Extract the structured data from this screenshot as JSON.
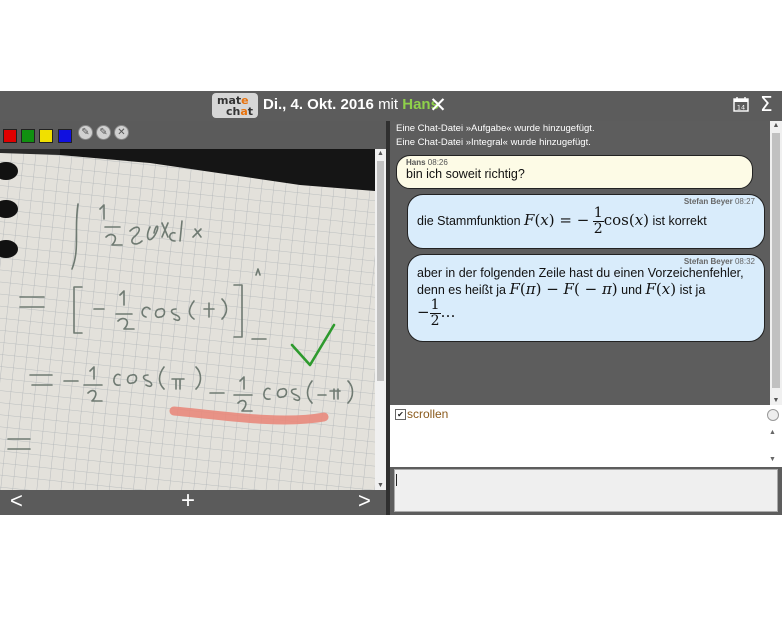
{
  "header": {
    "logo_line1": "mat",
    "logo_e1": "e",
    "logo_line2": "ch",
    "logo_e2": "a",
    "logo_line2b": "t",
    "date": "Di., 4. Okt. 2016",
    "mit": "mit",
    "partner": "Hans",
    "close_icon": "close-icon",
    "calendar_icon": "calendar-icon",
    "sigma_icon": "sigma-icon",
    "calendar_text": "14"
  },
  "toolbar": {
    "colors": [
      "#e00000",
      "#109010",
      "#f0e000",
      "#1010e0"
    ],
    "tools": [
      "pen-icon",
      "pen-icon",
      "clear-icon"
    ]
  },
  "navbar": {
    "prev": "<",
    "add": "+",
    "next": ">"
  },
  "chat": {
    "system_messages": [
      "Eine Chat-Datei »Aufgabe« wurde hinzugefügt.",
      "Eine Chat-Datei »Integral« wurde hinzugefügt."
    ],
    "messages": [
      {
        "author": "Hans",
        "time": "08:26",
        "text": "bin ich soweit richtig?"
      },
      {
        "author": "Stefan Beyer",
        "time": "08:27",
        "text_before": "die Stammfunktion",
        "text_after": "ist korrekt"
      },
      {
        "author": "Stefan Beyer",
        "time": "08:32",
        "line1": "aber in der folgenden Zeile hast du einen Vorzeichenfehler,",
        "line2_before": "denn es heißt ja",
        "line2_mid": "und",
        "line2_after": "ist ja"
      }
    ]
  },
  "controls": {
    "scroll_label": "scrollen",
    "scroll_checked": true
  },
  "input": {
    "value": ""
  },
  "colors": {
    "accent_name": "#8ed14a",
    "bubble_other": "#fdfbe6",
    "bubble_self": "#d9ecfb",
    "frame": "#5b5b5b"
  }
}
